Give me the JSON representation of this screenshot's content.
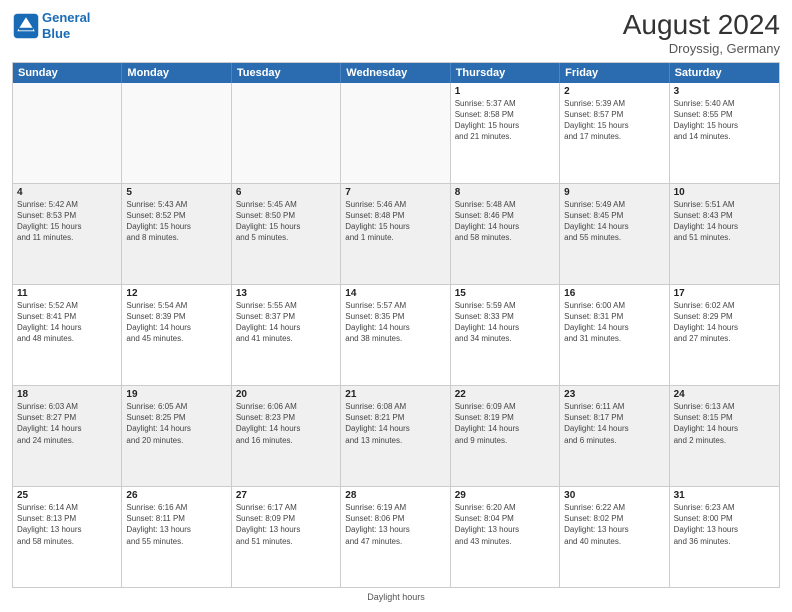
{
  "header": {
    "logo_line1": "General",
    "logo_line2": "Blue",
    "month": "August 2024",
    "location": "Droyssig, Germany"
  },
  "footer": {
    "label": "Daylight hours"
  },
  "days": [
    "Sunday",
    "Monday",
    "Tuesday",
    "Wednesday",
    "Thursday",
    "Friday",
    "Saturday"
  ],
  "rows": [
    [
      {
        "day": "",
        "info": ""
      },
      {
        "day": "",
        "info": ""
      },
      {
        "day": "",
        "info": ""
      },
      {
        "day": "",
        "info": ""
      },
      {
        "day": "1",
        "info": "Sunrise: 5:37 AM\nSunset: 8:58 PM\nDaylight: 15 hours\nand 21 minutes."
      },
      {
        "day": "2",
        "info": "Sunrise: 5:39 AM\nSunset: 8:57 PM\nDaylight: 15 hours\nand 17 minutes."
      },
      {
        "day": "3",
        "info": "Sunrise: 5:40 AM\nSunset: 8:55 PM\nDaylight: 15 hours\nand 14 minutes."
      }
    ],
    [
      {
        "day": "4",
        "info": "Sunrise: 5:42 AM\nSunset: 8:53 PM\nDaylight: 15 hours\nand 11 minutes."
      },
      {
        "day": "5",
        "info": "Sunrise: 5:43 AM\nSunset: 8:52 PM\nDaylight: 15 hours\nand 8 minutes."
      },
      {
        "day": "6",
        "info": "Sunrise: 5:45 AM\nSunset: 8:50 PM\nDaylight: 15 hours\nand 5 minutes."
      },
      {
        "day": "7",
        "info": "Sunrise: 5:46 AM\nSunset: 8:48 PM\nDaylight: 15 hours\nand 1 minute."
      },
      {
        "day": "8",
        "info": "Sunrise: 5:48 AM\nSunset: 8:46 PM\nDaylight: 14 hours\nand 58 minutes."
      },
      {
        "day": "9",
        "info": "Sunrise: 5:49 AM\nSunset: 8:45 PM\nDaylight: 14 hours\nand 55 minutes."
      },
      {
        "day": "10",
        "info": "Sunrise: 5:51 AM\nSunset: 8:43 PM\nDaylight: 14 hours\nand 51 minutes."
      }
    ],
    [
      {
        "day": "11",
        "info": "Sunrise: 5:52 AM\nSunset: 8:41 PM\nDaylight: 14 hours\nand 48 minutes."
      },
      {
        "day": "12",
        "info": "Sunrise: 5:54 AM\nSunset: 8:39 PM\nDaylight: 14 hours\nand 45 minutes."
      },
      {
        "day": "13",
        "info": "Sunrise: 5:55 AM\nSunset: 8:37 PM\nDaylight: 14 hours\nand 41 minutes."
      },
      {
        "day": "14",
        "info": "Sunrise: 5:57 AM\nSunset: 8:35 PM\nDaylight: 14 hours\nand 38 minutes."
      },
      {
        "day": "15",
        "info": "Sunrise: 5:59 AM\nSunset: 8:33 PM\nDaylight: 14 hours\nand 34 minutes."
      },
      {
        "day": "16",
        "info": "Sunrise: 6:00 AM\nSunset: 8:31 PM\nDaylight: 14 hours\nand 31 minutes."
      },
      {
        "day": "17",
        "info": "Sunrise: 6:02 AM\nSunset: 8:29 PM\nDaylight: 14 hours\nand 27 minutes."
      }
    ],
    [
      {
        "day": "18",
        "info": "Sunrise: 6:03 AM\nSunset: 8:27 PM\nDaylight: 14 hours\nand 24 minutes."
      },
      {
        "day": "19",
        "info": "Sunrise: 6:05 AM\nSunset: 8:25 PM\nDaylight: 14 hours\nand 20 minutes."
      },
      {
        "day": "20",
        "info": "Sunrise: 6:06 AM\nSunset: 8:23 PM\nDaylight: 14 hours\nand 16 minutes."
      },
      {
        "day": "21",
        "info": "Sunrise: 6:08 AM\nSunset: 8:21 PM\nDaylight: 14 hours\nand 13 minutes."
      },
      {
        "day": "22",
        "info": "Sunrise: 6:09 AM\nSunset: 8:19 PM\nDaylight: 14 hours\nand 9 minutes."
      },
      {
        "day": "23",
        "info": "Sunrise: 6:11 AM\nSunset: 8:17 PM\nDaylight: 14 hours\nand 6 minutes."
      },
      {
        "day": "24",
        "info": "Sunrise: 6:13 AM\nSunset: 8:15 PM\nDaylight: 14 hours\nand 2 minutes."
      }
    ],
    [
      {
        "day": "25",
        "info": "Sunrise: 6:14 AM\nSunset: 8:13 PM\nDaylight: 13 hours\nand 58 minutes."
      },
      {
        "day": "26",
        "info": "Sunrise: 6:16 AM\nSunset: 8:11 PM\nDaylight: 13 hours\nand 55 minutes."
      },
      {
        "day": "27",
        "info": "Sunrise: 6:17 AM\nSunset: 8:09 PM\nDaylight: 13 hours\nand 51 minutes."
      },
      {
        "day": "28",
        "info": "Sunrise: 6:19 AM\nSunset: 8:06 PM\nDaylight: 13 hours\nand 47 minutes."
      },
      {
        "day": "29",
        "info": "Sunrise: 6:20 AM\nSunset: 8:04 PM\nDaylight: 13 hours\nand 43 minutes."
      },
      {
        "day": "30",
        "info": "Sunrise: 6:22 AM\nSunset: 8:02 PM\nDaylight: 13 hours\nand 40 minutes."
      },
      {
        "day": "31",
        "info": "Sunrise: 6:23 AM\nSunset: 8:00 PM\nDaylight: 13 hours\nand 36 minutes."
      }
    ]
  ]
}
